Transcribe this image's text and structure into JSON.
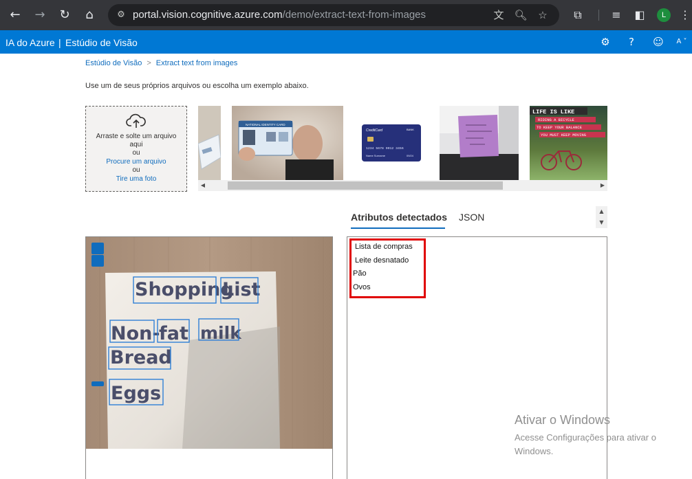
{
  "browser": {
    "url_host": "portal.vision.cognitive.azure.com",
    "url_path": "/demo/extract-text-from-images",
    "profile_initial": "L",
    "colors": {
      "toolbar": "#35363a",
      "omnibox": "#202124",
      "profile": "#1e8e3e"
    }
  },
  "header": {
    "brand": "IA do Azure",
    "divider": "|",
    "studio": "Estúdio de Visão",
    "accent": "#0078d4",
    "icons": [
      "settings-icon",
      "help-icon",
      "feedback-smiley-icon",
      "account-icon"
    ],
    "account_letter": "A"
  },
  "breadcrumb": {
    "home": "Estúdio de Visão",
    "separator": ">",
    "current": "Extract text from images"
  },
  "intro": "Use um de seus próprios arquivos ou escolha um exemplo abaixo.",
  "upload": {
    "drag_text": "Arraste e solte um arquivo aqui",
    "or1": "ou",
    "browse_link": "Procure um arquivo",
    "or2": "ou",
    "photo_link": "Tire uma foto"
  },
  "samples": {
    "id_card_text": "NATIONAL IDENTITY CARD",
    "credit_card": {
      "brand": "CreditCard",
      "bank": "BANK",
      "number": "1234 5678 9012 3456",
      "name": "Name Surname",
      "expiry": "09/24"
    },
    "poster_lines": [
      "LIFE IS LIKE",
      "RIDING A BICYCLE",
      "TO KEEP YOUR BALANCE",
      "YOU MUST KEEP MOVING"
    ]
  },
  "tabs": {
    "detected": "Atributos detectados",
    "json": "JSON"
  },
  "note_image": {
    "words": [
      "Shopping",
      "List",
      "Non-",
      "fat",
      "milk",
      "Bread",
      "Eggs"
    ]
  },
  "results": {
    "lines": [
      "Lista  de compras",
      "Leite  desnatado",
      "Pão",
      "Ovos"
    ],
    "highlight_color": "#e00000"
  },
  "watermark": {
    "title": "Ativar o Windows",
    "subtitle": "Acesse Configurações para ativar o Windows."
  }
}
